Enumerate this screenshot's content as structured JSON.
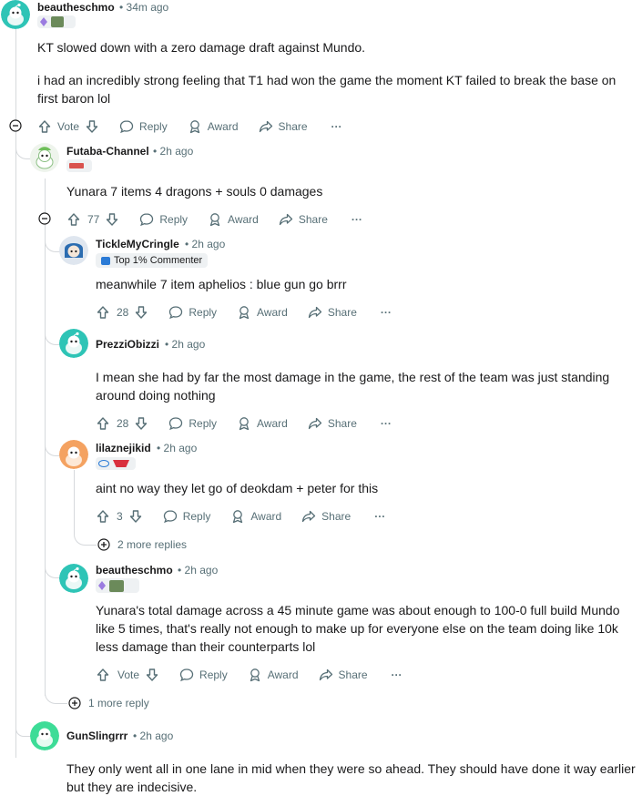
{
  "colors": {
    "accent_teal": "#2ec4b6",
    "text_meta": "#576f76",
    "line": "#d6d9dc"
  },
  "labels": {
    "vote": "Vote",
    "reply": "Reply",
    "award": "Award",
    "share": "Share",
    "more": "···"
  },
  "comments": [
    {
      "username": "beautheschmo",
      "time": "• 34m ago",
      "flair_icons": [
        "diamond-flair-icon",
        "fredit-flair-icon"
      ],
      "body": [
        "KT slowed down with a zero damage draft against Mundo.",
        "i had an incredibly strong feeling that T1 had won the game the moment KT failed to break the base on first baron lol"
      ],
      "score": "Vote"
    },
    {
      "username": "Futaba-Channel",
      "time": "• 2h ago",
      "flair_icons": [
        "team-flair-icon"
      ],
      "body": [
        "Yunara 7 items 4 dragons + souls 0 damages"
      ],
      "score": "77"
    },
    {
      "username": "TickleMyCringle",
      "time": "• 2h ago",
      "badge": "Top 1% Commenter",
      "body": [
        "meanwhile 7 item aphelios : blue gun go brrr"
      ],
      "score": "28"
    },
    {
      "username": "PrezziObizzi",
      "time": "• 2h ago",
      "body": [
        "I mean she had by far the most damage in the game, the rest of the team was just standing around doing nothing"
      ],
      "score": "28"
    },
    {
      "username": "lilaznejikid",
      "time": "• 2h ago",
      "flair_icons": [
        "infinity-flair-icon",
        "t1-flair-icon"
      ],
      "body": [
        "aint no way they let go of deokdam + peter for this"
      ],
      "score": "3"
    },
    {
      "more_replies": "2 more replies"
    },
    {
      "username": "beautheschmo",
      "time": "• 2h ago",
      "flair_icons": [
        "diamond-flair-icon",
        "fredit-flair-icon"
      ],
      "body": [
        "Yunara's total damage across a 45 minute game was about enough to 100-0 full build Mundo like 5 times, that's really not enough to make up for everyone else on the team doing like 10k less damage than their counterparts lol"
      ],
      "score": "Vote"
    },
    {
      "more_replies": "1 more reply"
    },
    {
      "username": "GunSlingrrr",
      "time": "• 2h ago",
      "body": [
        "They only went all in one lane in mid when they were so ahead. They should have done it way earlier but they are indecisive."
      ]
    }
  ]
}
